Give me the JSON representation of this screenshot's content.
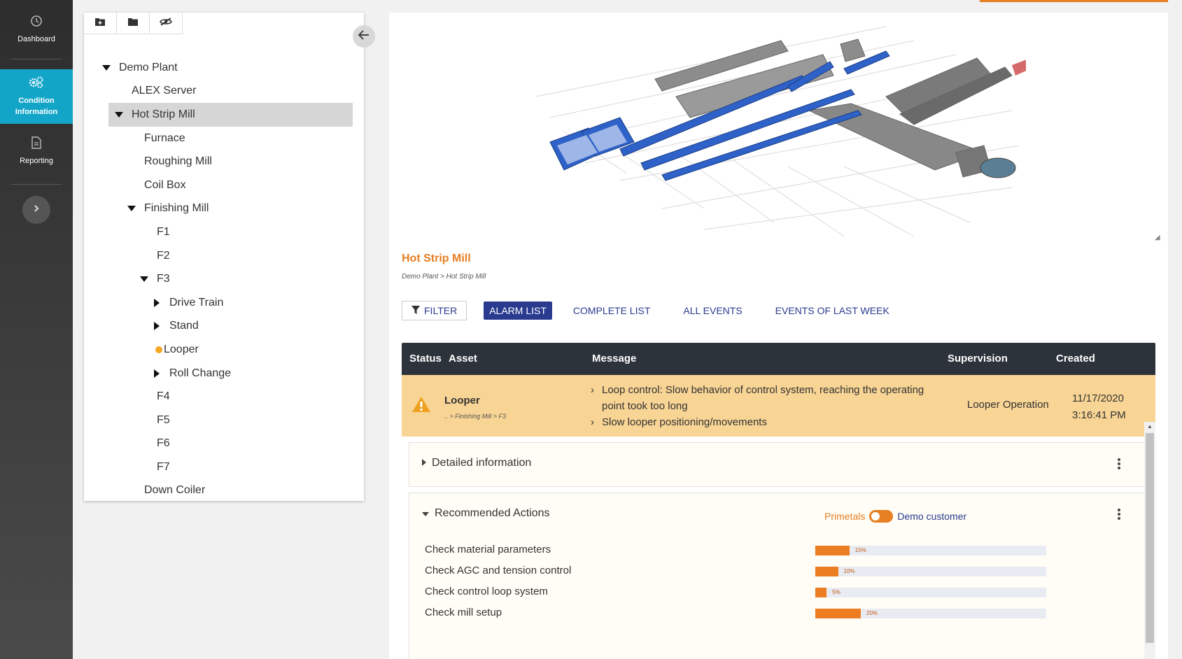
{
  "nav": {
    "items": [
      {
        "label": "Dashboard",
        "icon": "clock-icon"
      },
      {
        "label": "Condition Information",
        "icon": "gears-icon",
        "active": true
      },
      {
        "label": "Reporting",
        "icon": "document-icon"
      }
    ]
  },
  "tree": {
    "items": [
      {
        "label": "Demo Plant",
        "level": 0,
        "toggle": "expanded"
      },
      {
        "label": "ALEX Server",
        "level": 1,
        "toggle": "none"
      },
      {
        "label": "Hot Strip Mill",
        "level": 1,
        "toggle": "expanded",
        "selected": true
      },
      {
        "label": "Furnace",
        "level": 2,
        "toggle": "none"
      },
      {
        "label": "Roughing Mill",
        "level": 2,
        "toggle": "none"
      },
      {
        "label": "Coil Box",
        "level": 2,
        "toggle": "none"
      },
      {
        "label": "Finishing Mill",
        "level": 2,
        "toggle": "expanded"
      },
      {
        "label": "F1",
        "level": 3,
        "toggle": "none"
      },
      {
        "label": "F2",
        "level": 3,
        "toggle": "none"
      },
      {
        "label": "F3",
        "level": 3,
        "toggle": "expanded"
      },
      {
        "label": "Drive Train",
        "level": 4,
        "toggle": "collapsed"
      },
      {
        "label": "Stand",
        "level": 4,
        "toggle": "collapsed"
      },
      {
        "label": "Looper",
        "level": 4,
        "toggle": "alarm"
      },
      {
        "label": "Roll Change",
        "level": 4,
        "toggle": "collapsed"
      },
      {
        "label": "F4",
        "level": 3,
        "toggle": "none"
      },
      {
        "label": "F5",
        "level": 3,
        "toggle": "none"
      },
      {
        "label": "F6",
        "level": 3,
        "toggle": "none"
      },
      {
        "label": "F7",
        "level": 3,
        "toggle": "none"
      },
      {
        "label": "Down Coiler",
        "level": 2,
        "toggle": "none"
      }
    ]
  },
  "main": {
    "title": "Hot Strip Mill",
    "breadcrumb": "Demo Plant  >  Hot Strip Mill",
    "tabs": {
      "filter": "FILTER",
      "alarm_list": "ALARM LIST",
      "complete_list": "COMPLETE LIST",
      "all_events": "ALL EVENTS",
      "last_week": "EVENTS OF LAST WEEK"
    },
    "table": {
      "headers": {
        "status": "Status",
        "asset": "Asset",
        "message": "Message",
        "supervision": "Supervision",
        "created": "Created"
      },
      "alarm": {
        "asset": "Looper",
        "path": "..  > Finishing Mill   > F3",
        "messages": [
          "Loop control: Slow behavior of control system, reaching the operating point took too long",
          "Slow looper positioning/movements"
        ],
        "supervision": "Looper Operation",
        "created_date": "11/17/2020",
        "created_time": "3:16:41 PM"
      }
    },
    "detailed_info": "Detailed information",
    "recommended": {
      "title": "Recommended Actions",
      "toggle_left": "Primetals",
      "toggle_right": "Demo customer",
      "actions": [
        {
          "label": "Check material parameters",
          "percent": 15,
          "percent_label": "15%"
        },
        {
          "label": "Check AGC and tension control",
          "percent": 10,
          "percent_label": "10%"
        },
        {
          "label": "Check control loop system",
          "percent": 5,
          "percent_label": "5%"
        },
        {
          "label": "Check mill setup",
          "percent": 20,
          "percent_label": "20%"
        }
      ]
    }
  },
  "colors": {
    "accent": "#e67e22",
    "nav_active": "#12a5c8",
    "tab_active": "#2a3b8f",
    "alarm_bg": "#f8d495"
  }
}
